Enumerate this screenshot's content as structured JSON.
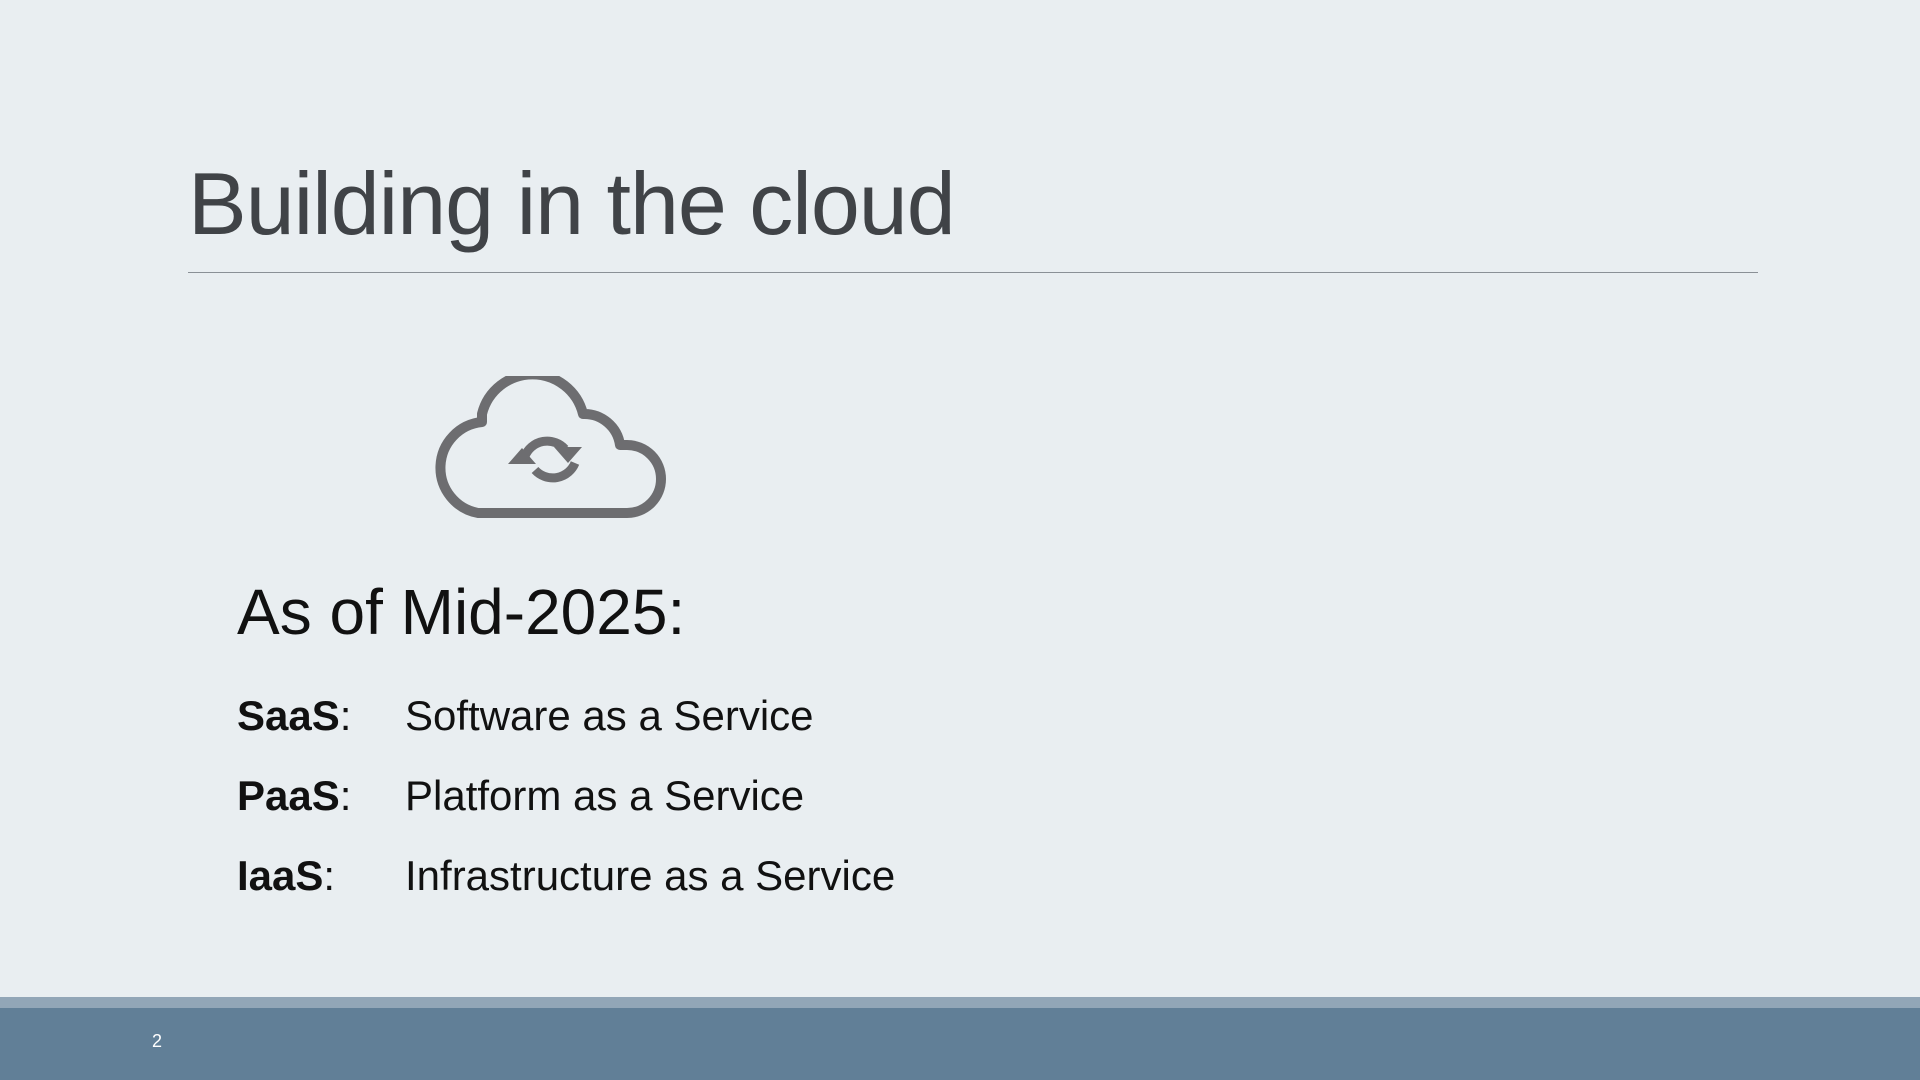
{
  "slide": {
    "title": "Building in the cloud",
    "subtitle": "As of Mid-2025:",
    "icon": "cloud-sync-icon",
    "definitions": [
      {
        "term": "SaaS",
        "separator": ":",
        "text": "Software as a Service"
      },
      {
        "term": "PaaS",
        "separator": ":",
        "text": "Platform as a Service"
      },
      {
        "term": "IaaS",
        "separator": ":",
        "text": "Infrastructure as a Service"
      }
    ],
    "page_number": "2"
  },
  "colors": {
    "background": "#e9eef1",
    "title_text": "#404347",
    "body_text": "#111111",
    "icon": "#6d6d70",
    "footer_bar": "#617f97",
    "footer_stripe": "#92a6b7"
  }
}
